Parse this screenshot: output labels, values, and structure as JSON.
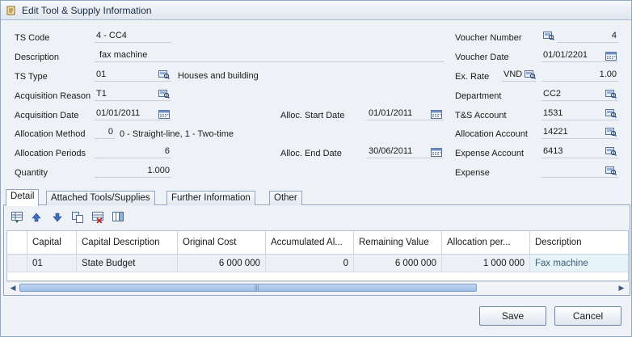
{
  "window": {
    "title": "Edit Tool & Supply Information"
  },
  "form": {
    "ts_code": {
      "label": "TS Code",
      "value": "4 - CC4"
    },
    "description": {
      "label": "Description",
      "value": "fax machine"
    },
    "ts_type": {
      "label": "TS Type",
      "value": "01",
      "text": "Houses and building"
    },
    "acquisition_reason": {
      "label": "Acquisition Reason",
      "value": "T1"
    },
    "acquisition_date": {
      "label": "Acquisition Date",
      "value": "01/01/2011"
    },
    "allocation_method": {
      "label": "Allocation Method",
      "value": "0",
      "hint": "0 - Straight-line, 1 - Two-time"
    },
    "allocation_periods": {
      "label": "Allocation Periods",
      "value": "6"
    },
    "quantity": {
      "label": "Quantity",
      "value": "1.000"
    },
    "alloc_start_date": {
      "label": "Alloc. Start Date",
      "value": "01/01/2011"
    },
    "alloc_end_date": {
      "label": "Alloc. End Date",
      "value": "30/06/2011"
    },
    "voucher_number": {
      "label": "Voucher Number",
      "value": "4"
    },
    "voucher_date": {
      "label": "Voucher Date",
      "value": "01/01/2201"
    },
    "ex_rate": {
      "label": "Ex. Rate",
      "currency": "VND",
      "value": "1.00"
    },
    "department": {
      "label": "Department",
      "value": "CC2"
    },
    "ts_account": {
      "label": "T&S Account",
      "value": "1531"
    },
    "allocation_account": {
      "label": "Allocation Account",
      "value": "14221"
    },
    "expense_account": {
      "label": "Expense Account",
      "value": "6413"
    },
    "expense": {
      "label": "Expense",
      "value": ""
    }
  },
  "tabs": [
    "Detail",
    "Attached Tools/Supplies",
    "Further Information",
    "Other"
  ],
  "grid": {
    "columns": [
      "Capital",
      "Capital Description",
      "Original Cost",
      "Accumulated Al...",
      "Remaining Value",
      "Allocation per...",
      "Description"
    ],
    "rows": [
      [
        "01",
        "State Budget",
        "6 000 000",
        "0",
        "6 000 000",
        "1 000 000",
        "Fax machine"
      ]
    ]
  },
  "buttons": {
    "save": "Save",
    "cancel": "Cancel"
  },
  "icons": {
    "title": "document-edit-icon",
    "lookup": "lookup-icon",
    "calendar": "calendar-icon",
    "toolbar": [
      "insert-row-icon",
      "move-up-icon",
      "move-down-icon",
      "copy-icon",
      "delete-row-icon",
      "columns-icon"
    ]
  },
  "colors": {
    "accent": "#8fa6c4",
    "highlight_cell": "#e6f3f8",
    "scroll_thumb": "#9fbde8"
  }
}
